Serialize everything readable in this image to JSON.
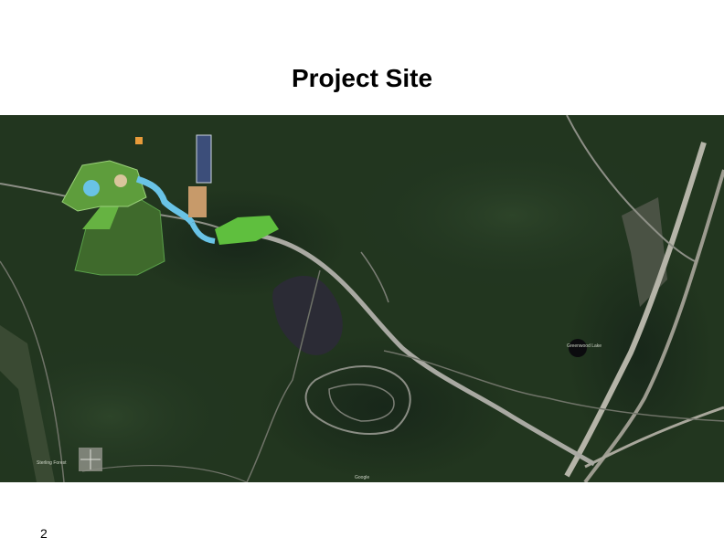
{
  "page": {
    "title": "Project Site",
    "page_number": "2"
  },
  "map": {
    "imagery": "satellite",
    "colors": {
      "forest": "#1f3220",
      "highway": "#a9a9a2",
      "road": "#8d8f86",
      "water": "#2b2b35",
      "plan_water": "#69c3e6",
      "plan_green": "#5fbf3e"
    },
    "watermark": "Google",
    "small_labels": [
      "Greenwood Lake",
      "Sterling Forest"
    ]
  }
}
